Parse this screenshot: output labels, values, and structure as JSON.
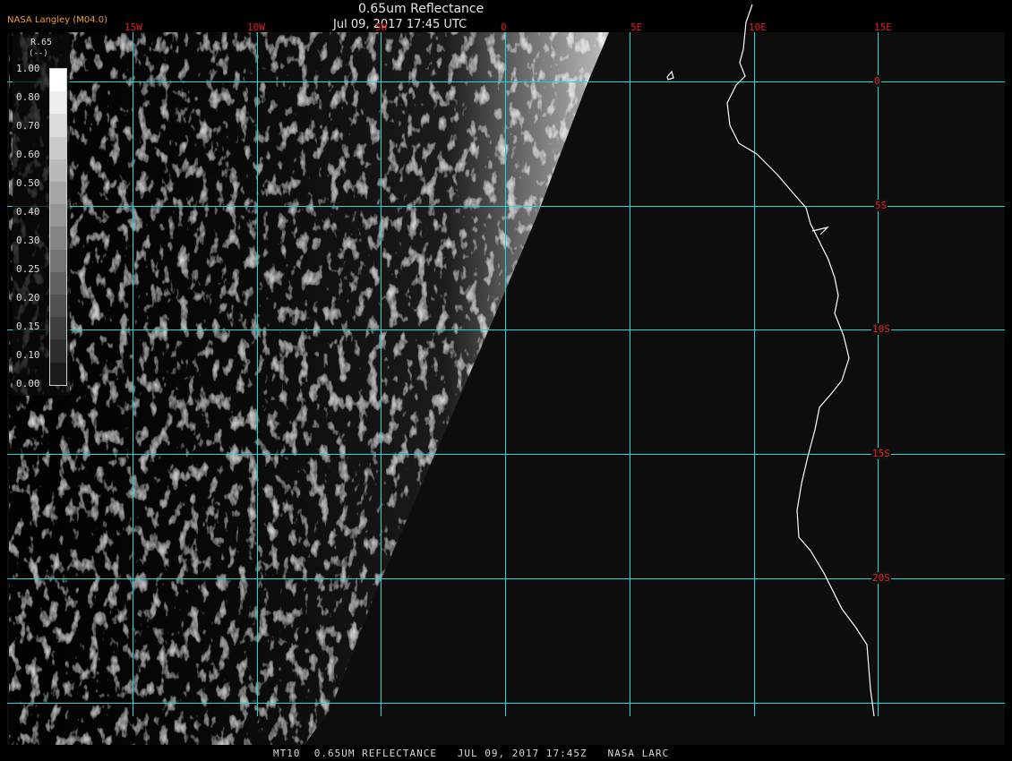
{
  "header": {
    "title": "0.65um Reflectance",
    "timestamp": "Jul 09, 2017 17:45 UTC",
    "organization": "NASA Langley (M04.0)"
  },
  "lon_labels": [
    "15W",
    "10W",
    "5W",
    "0",
    "5E",
    "10E",
    "15E"
  ],
  "lat_labels": [
    "0",
    "5S",
    "10S",
    "15S",
    "20S"
  ],
  "legend": {
    "title": "R.65",
    "unit": "(--)",
    "ticks": [
      "1.00",
      "0.80",
      "0.70",
      "0.60",
      "0.50",
      "0.40",
      "0.30",
      "0.25",
      "0.20",
      "0.15",
      "0.10",
      "0.00"
    ],
    "shades": [
      "#ffffff",
      "#ededed",
      "#dcdcdc",
      "#cacaca",
      "#b9b9b9",
      "#a7a7a7",
      "#969696",
      "#848484",
      "#737373",
      "#616161",
      "#505050",
      "#3e3e3e",
      "#2d2d2d",
      "#1b1b1b"
    ]
  },
  "footer": "MT10  0.65UM REFLECTANCE   JUL 09, 2017 17:45Z   NASA LARC",
  "colors": {
    "grid": "#20d8d8",
    "coastline": "#ffffff",
    "labels": "#e02020",
    "background": "#0d0d0d",
    "org_text": "#f0a030"
  }
}
